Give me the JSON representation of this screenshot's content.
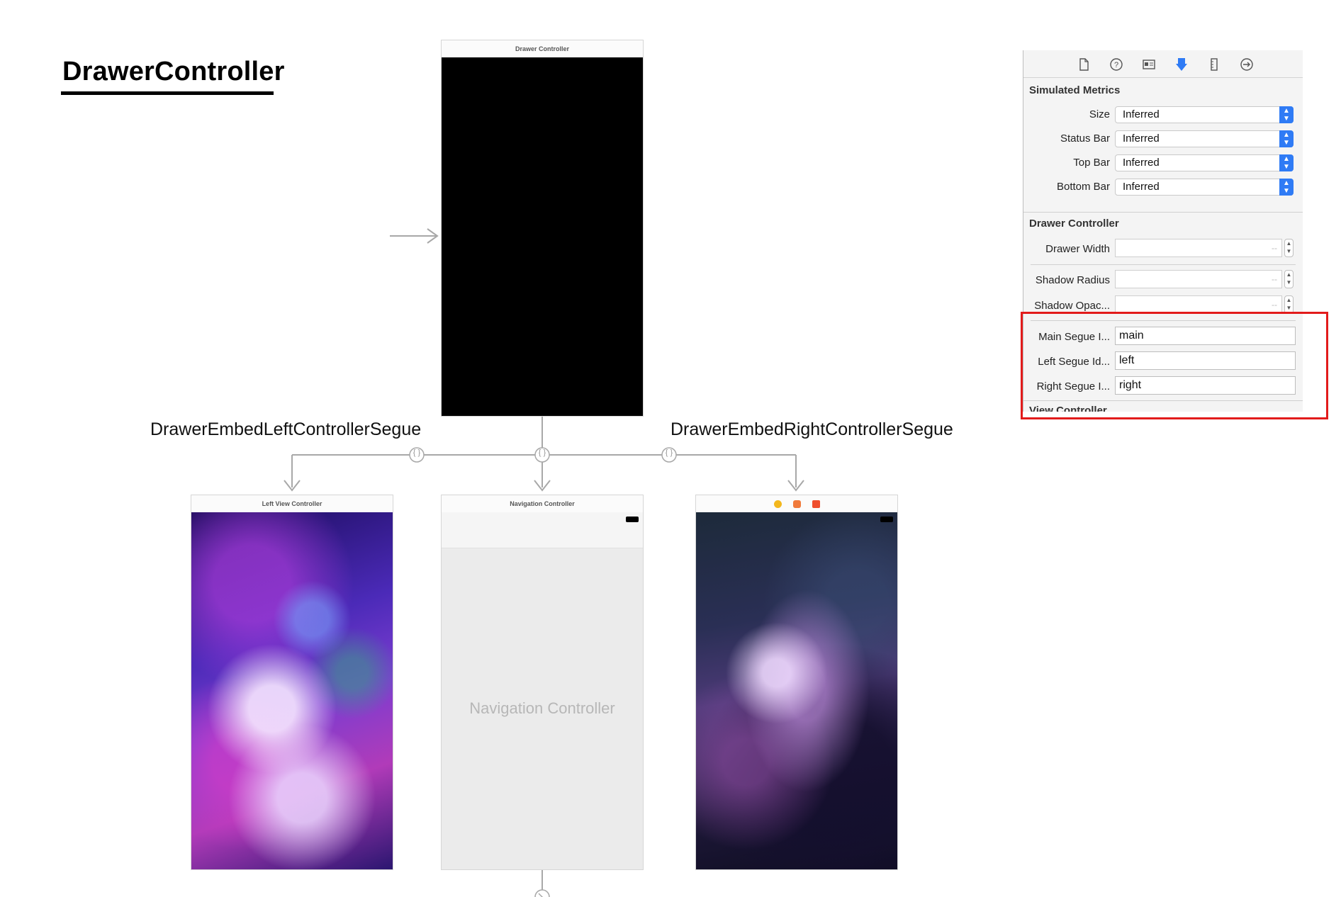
{
  "heading": "DrawerController",
  "scenes": {
    "drawer": {
      "title": "Drawer Controller"
    },
    "left": {
      "title": "Left View Controller"
    },
    "navigation": {
      "title": "Navigation Controller",
      "body_label": "Navigation Controller"
    },
    "right": {
      "title": ""
    }
  },
  "segues": {
    "left_label": "DrawerEmbedLeftControllerSegue",
    "right_label": "DrawerEmbedRightControllerSegue",
    "embed_icon": "{ }"
  },
  "inspector": {
    "toolbar_icons": [
      "file-icon",
      "help-icon",
      "identity-icon",
      "attributes-icon",
      "size-icon",
      "connections-icon"
    ],
    "simulated_metrics": {
      "title": "Simulated Metrics",
      "rows": [
        {
          "label": "Size",
          "value": "Inferred"
        },
        {
          "label": "Status Bar",
          "value": "Inferred"
        },
        {
          "label": "Top Bar",
          "value": "Inferred"
        },
        {
          "label": "Bottom Bar",
          "value": "Inferred"
        }
      ]
    },
    "drawer_controller": {
      "title": "Drawer Controller",
      "numeric_rows": [
        {
          "label": "Drawer Width",
          "placeholder": "--"
        },
        {
          "label": "Shadow Radius",
          "placeholder": "--"
        },
        {
          "label": "Shadow Opac...",
          "placeholder": "--"
        }
      ],
      "text_rows": [
        {
          "label": "Main Segue I...",
          "value": "main"
        },
        {
          "label": "Left Segue Id...",
          "value": "left"
        },
        {
          "label": "Right Segue I...",
          "value": "right"
        }
      ]
    },
    "next_section_title": "View Controller"
  },
  "colors": {
    "accent": "#2f7bf5",
    "highlight": "#e21b1b",
    "drawer_view": "#000000",
    "nav_body": "#ebebeb"
  }
}
